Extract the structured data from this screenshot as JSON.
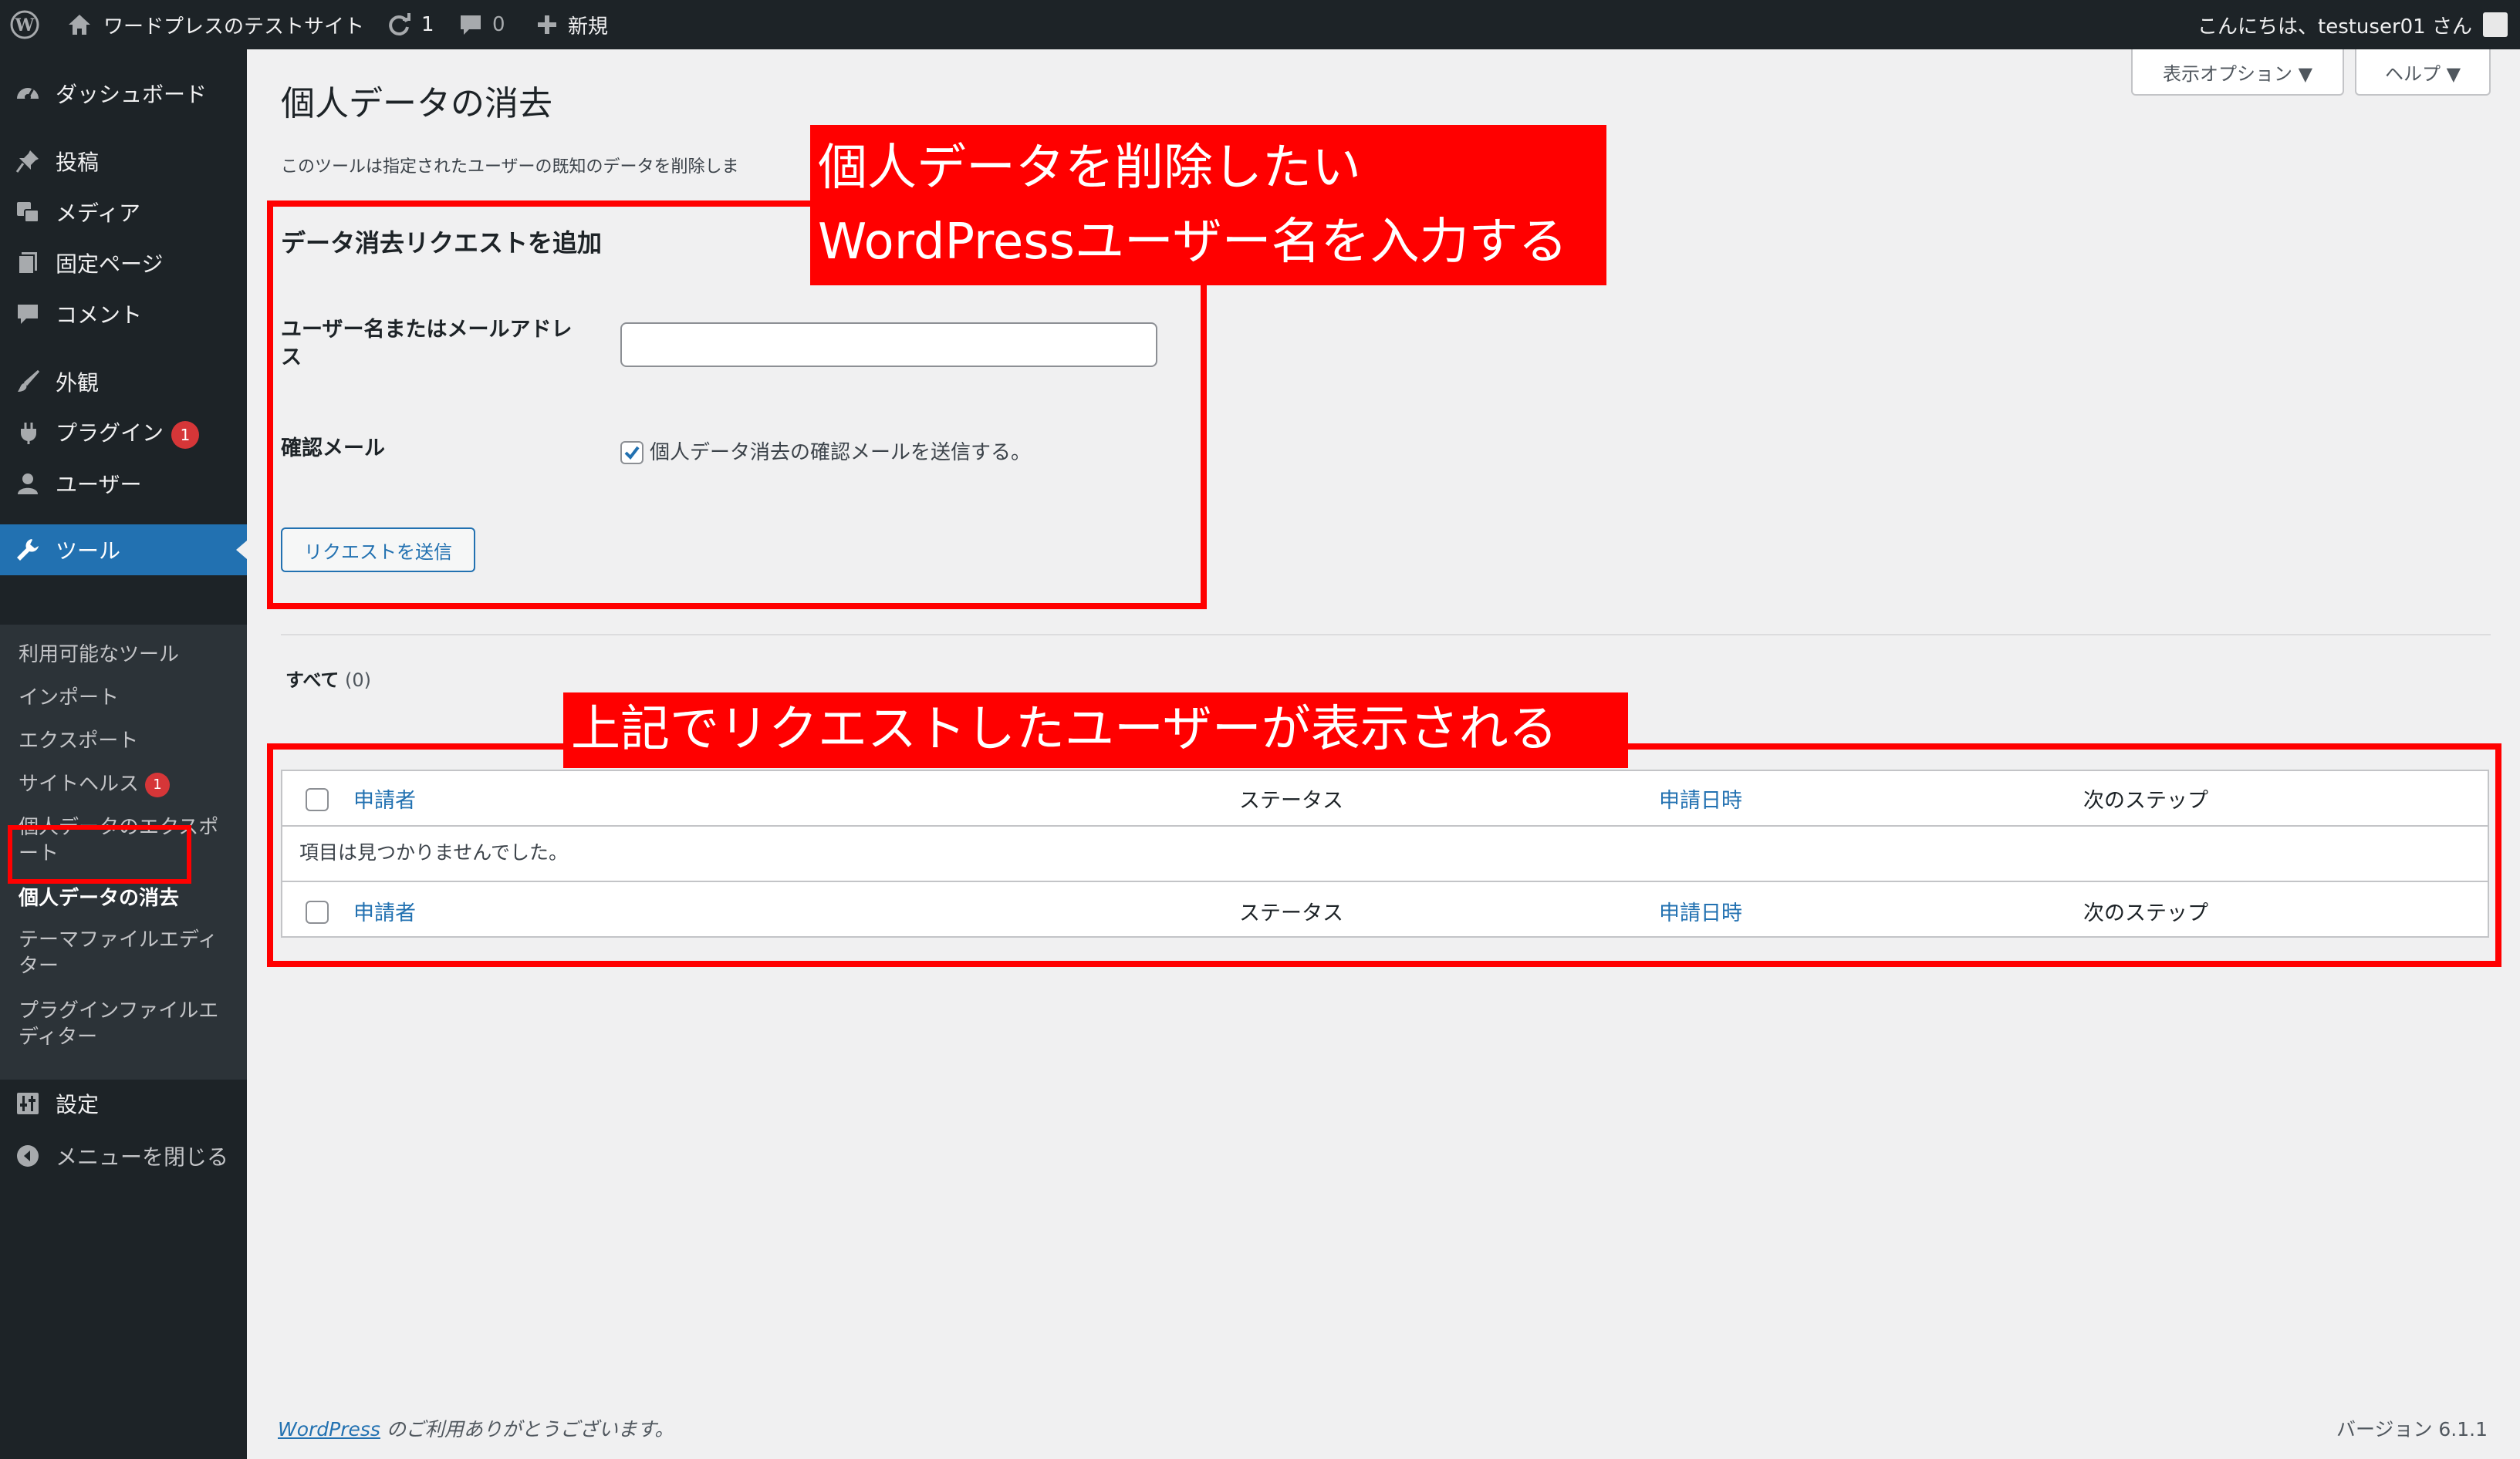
{
  "adminbar": {
    "site_name": "ワードプレスのテストサイト",
    "updates_count": "1",
    "comments_count": "0",
    "new_label": "新規",
    "greeting": "こんにちは、testuser01 さん"
  },
  "sidebar": {
    "items": [
      {
        "label": "ダッシュボード",
        "icon": "dashboard-icon"
      },
      {
        "label": "投稿",
        "icon": "pin-icon"
      },
      {
        "label": "メディア",
        "icon": "media-icon"
      },
      {
        "label": "固定ページ",
        "icon": "page-icon"
      },
      {
        "label": "コメント",
        "icon": "comment-icon"
      },
      {
        "label": "外観",
        "icon": "brush-icon"
      },
      {
        "label": "プラグイン",
        "icon": "plugin-icon",
        "badge": "1"
      },
      {
        "label": "ユーザー",
        "icon": "user-icon"
      },
      {
        "label": "ツール",
        "icon": "wrench-icon"
      },
      {
        "label": "設定",
        "icon": "settings-icon"
      },
      {
        "label": "メニューを閉じる",
        "icon": "collapse-icon"
      }
    ],
    "submenu": [
      {
        "label": "利用可能なツール"
      },
      {
        "label": "インポート"
      },
      {
        "label": "エクスポート"
      },
      {
        "label": "サイトヘルス",
        "badge": "1"
      },
      {
        "label": "個人データのエクスポート"
      },
      {
        "label": "個人データの消去"
      },
      {
        "label": "テーマファイルエディター"
      },
      {
        "label": "プラグインファイルエディター"
      }
    ]
  },
  "screen_meta": {
    "options_label": "表示オプション ▼",
    "help_label": "ヘルプ ▼"
  },
  "main": {
    "title": "個人データの消去",
    "description": "このツールは指定されたユーザーの既知のデータを削除しま",
    "form_heading": "データ消去リクエストを追加",
    "username_label": "ユーザー名またはメールアドレス",
    "username_value": "",
    "confirm_label": "確認メール",
    "confirm_checkbox_label": "個人データ消去の確認メールを送信する。",
    "confirm_checked": true,
    "submit_label": "リクエストを送信",
    "filter_label": "すべて",
    "filter_count": "(0)"
  },
  "table": {
    "columns": [
      "申請者",
      "ステータス",
      "申請日時",
      "次のステップ"
    ],
    "empty_message": "項目は見つかりませんでした。"
  },
  "annotations": {
    "form_note_line1": "個人データを削除したい",
    "form_note_line2": "WordPressユーザー名を入力する",
    "table_note": "上記でリクエストしたユーザーが表示される"
  },
  "footer": {
    "wp_link": "WordPress",
    "thanks": " のご利用ありがとうございます。",
    "version": "バージョン 6.1.1"
  },
  "colors": {
    "adminbar_bg": "#1d2327",
    "accent": "#2271b1",
    "badge": "#d63638",
    "annotation": "#ff0000"
  }
}
